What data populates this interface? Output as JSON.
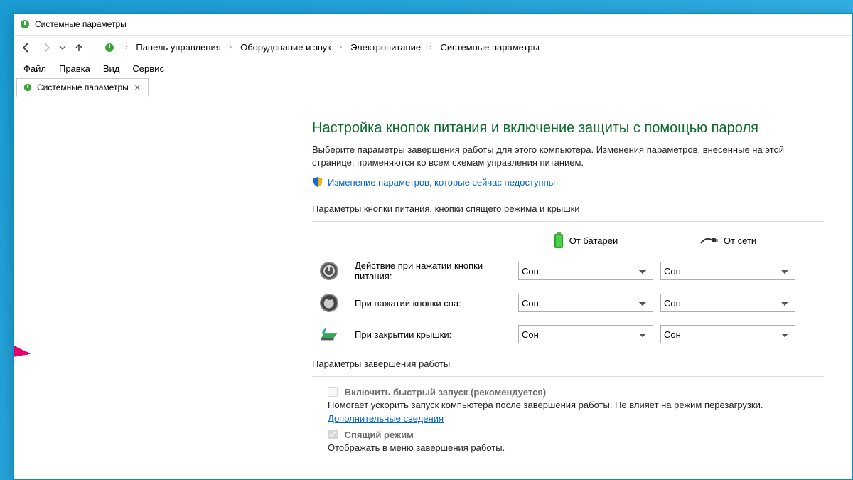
{
  "window": {
    "title": "Системные параметры"
  },
  "breadcrumb": {
    "items": [
      "Панель управления",
      "Оборудование и звук",
      "Электропитание",
      "Системные параметры"
    ]
  },
  "menubar": {
    "items": [
      "Файл",
      "Правка",
      "Вид",
      "Сервис"
    ]
  },
  "tab": {
    "label": "Cистемные параметры"
  },
  "page": {
    "title": "Настройка кнопок питания и включение защиты с помощью пароля",
    "desc": "Выберите параметры завершения работы для этого компьютера. Изменения параметров, внесенные на этой странице, применяются ко всем схемам управления питанием.",
    "admin_link": "Изменение параметров, которые сейчас недоступны"
  },
  "buttons_section": {
    "heading": "Параметры кнопки питания, кнопки спящего режима и крышки",
    "col_battery": "От батареи",
    "col_ac": "От сети",
    "rows": [
      {
        "label": "Действие при нажатии кнопки питания:",
        "battery": "Сон",
        "ac": "Сон"
      },
      {
        "label": "При нажатии кнопки сна:",
        "battery": "Сон",
        "ac": "Сон"
      },
      {
        "label": "При закрытии крышки:",
        "battery": "Сон",
        "ac": "Сон"
      }
    ]
  },
  "shutdown_section": {
    "heading": "Параметры завершения работы",
    "faststart_label": "Включить быстрый запуск (рекомендуется)",
    "faststart_desc": "Помогает ускорить запуск компьютера после завершения работы. Не влияет на режим перезагрузки. ",
    "faststart_link": "Дополнительные сведения",
    "sleep_label": "Спящий режим",
    "sleep_desc": "Отображать в меню завершения работы."
  }
}
